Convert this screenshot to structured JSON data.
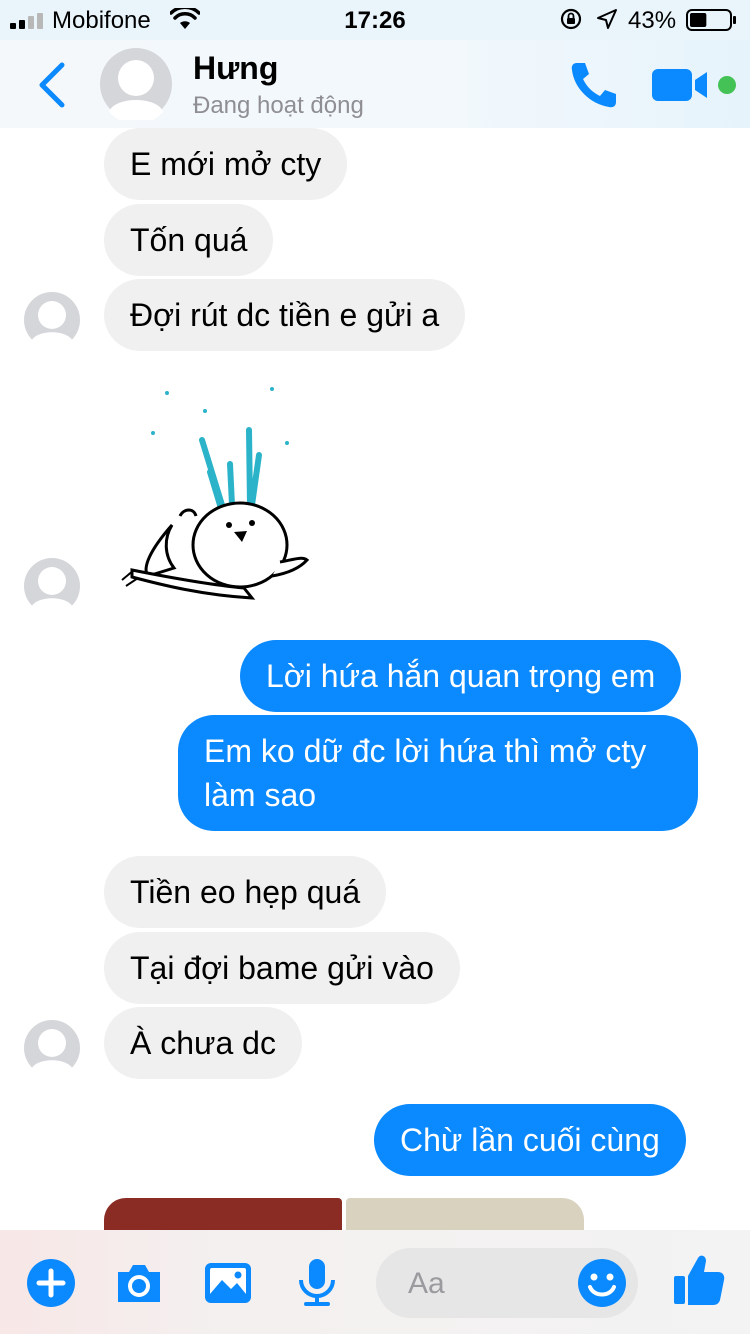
{
  "status_bar": {
    "carrier": "Mobifone",
    "time": "17:26",
    "battery_percent": "43%",
    "battery_level": 0.43
  },
  "header": {
    "contact_name": "Hưng",
    "contact_status": "Đang hoạt động",
    "icons": [
      "back-icon",
      "avatar",
      "phone-icon",
      "video-camera-icon",
      "online-dot"
    ],
    "accent_color": "#0b89ff",
    "online_color": "#44c256"
  },
  "messages": [
    {
      "from": "them",
      "text": "E mới mở cty"
    },
    {
      "from": "them",
      "text": "Tốn quá"
    },
    {
      "from": "them",
      "text": "Đợi rút dc tiền e gửi a"
    },
    {
      "from": "them",
      "type": "sticker",
      "icon": "sticker-icon"
    },
    {
      "from": "me",
      "text": "Lời hứa hắn quan trọng em"
    },
    {
      "from": "me",
      "text": "Em ko dữ đc lời hứa thì mở cty làm sao"
    },
    {
      "from": "them",
      "text": "Tiền eo hẹp quá"
    },
    {
      "from": "them",
      "text": "Tại đợi bame gửi vào"
    },
    {
      "from": "them",
      "text": "À chưa dc"
    },
    {
      "from": "me",
      "text": "Chừ lần cuối cùng"
    },
    {
      "from": "them",
      "type": "photos",
      "icon": "image-thumbnail"
    }
  ],
  "composer": {
    "placeholder": "Aa",
    "icons": [
      "plus-icon",
      "camera-icon",
      "gallery-icon",
      "microphone-icon",
      "emoji-icon",
      "thumbs-up-icon"
    ]
  }
}
